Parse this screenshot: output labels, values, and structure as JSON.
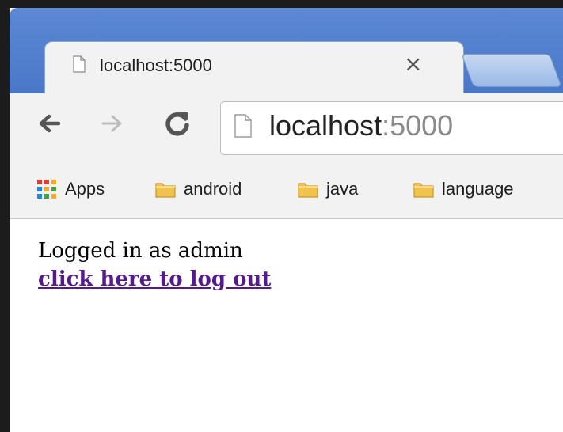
{
  "tab": {
    "title": "localhost:5000",
    "close": "×"
  },
  "address_bar": {
    "host": "localhost",
    "port": ":5000"
  },
  "bookmarks": [
    {
      "label": "Apps",
      "icon": "apps-grid-icon"
    },
    {
      "label": "android",
      "icon": "folder-icon"
    },
    {
      "label": "java",
      "icon": "folder-icon"
    },
    {
      "label": "language",
      "icon": "folder-icon"
    }
  ],
  "page": {
    "status_text": "Logged in as admin",
    "logout_link": "click here to log out"
  },
  "colors": {
    "titlebar": "#4a78c8",
    "link_visited": "#551a8b",
    "folder": "#f0c24e"
  }
}
